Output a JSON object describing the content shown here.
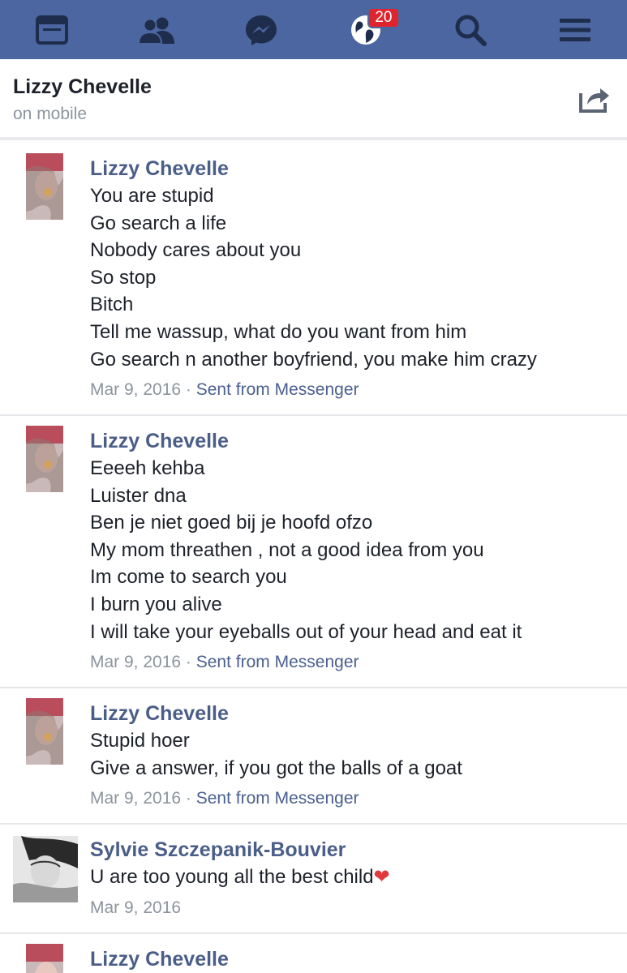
{
  "nav": {
    "items": [
      "news-feed",
      "friend-requests",
      "messages",
      "notifications",
      "search",
      "menu"
    ],
    "notification_count": "20"
  },
  "header": {
    "name": "Lizzy Chevelle",
    "status": "on mobile"
  },
  "messages": [
    {
      "sender": "Lizzy Chevelle",
      "lines": [
        "You are stupid",
        "Go search a life",
        "Nobody cares about you",
        "So stop",
        "Bitch",
        "Tell me wassup, what do you want from him",
        "Go search n another boyfriend, you make him crazy"
      ],
      "date": "Mar 9, 2016",
      "separator": " · ",
      "source": "Sent from Messenger"
    },
    {
      "sender": "Lizzy Chevelle",
      "lines": [
        "Eeeeh kehba",
        "Luister dna",
        "Ben je niet goed bij je hoofd ofzo",
        "My mom threathen , not a good idea from you",
        "Im come to search you",
        "I burn you alive",
        "I will take your eyeballs out of your head and eat it"
      ],
      "date": "Mar 9, 2016",
      "separator": " · ",
      "source": "Sent from Messenger"
    },
    {
      "sender": "Lizzy Chevelle",
      "lines": [
        "Stupid hoer",
        "Give a answer, if you got the balls of a goat"
      ],
      "date": "Mar 9, 2016",
      "separator": " · ",
      "source": "Sent from Messenger"
    },
    {
      "sender": "Sylvie Szczepanik-Bouvier",
      "lines": [
        "U are too young all the best child"
      ],
      "heart": "❤",
      "date": "Mar 9, 2016"
    },
    {
      "sender": "Lizzy Chevelle"
    }
  ],
  "colors": {
    "topbar": "#4b66a0",
    "badge": "#e0242e",
    "sender": "#4b5e88",
    "meta": "#8d949e"
  }
}
